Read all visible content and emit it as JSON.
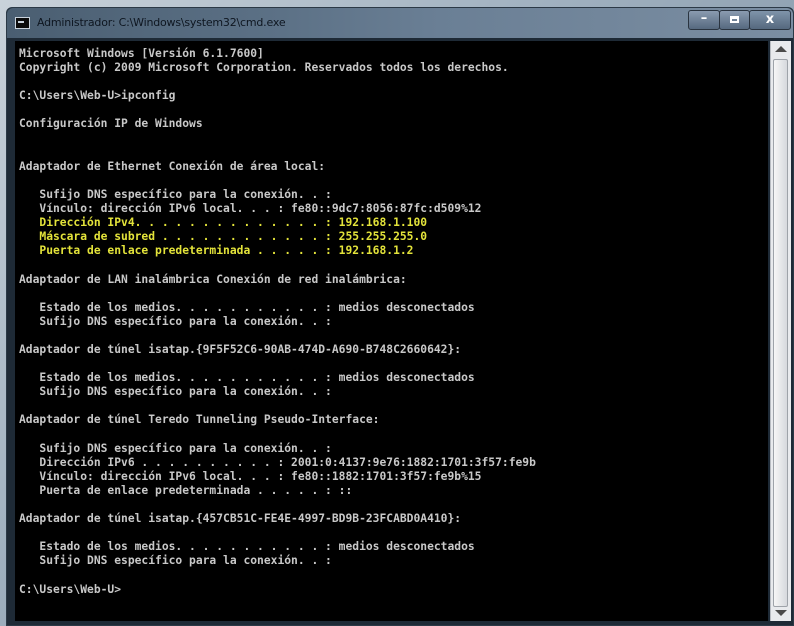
{
  "window": {
    "title": "Administrador: C:\\Windows\\system32\\cmd.exe",
    "controls": {
      "minimize": "–",
      "close": "x"
    }
  },
  "console": {
    "lines": [
      {
        "text": "Microsoft Windows [Versión 6.1.7600]",
        "highlight": false
      },
      {
        "text": "Copyright (c) 2009 Microsoft Corporation. Reservados todos los derechos.",
        "highlight": false
      },
      {
        "text": "",
        "highlight": false
      },
      {
        "text": "C:\\Users\\Web-U>ipconfig",
        "highlight": false
      },
      {
        "text": "",
        "highlight": false
      },
      {
        "text": "Configuración IP de Windows",
        "highlight": false
      },
      {
        "text": "",
        "highlight": false
      },
      {
        "text": "",
        "highlight": false
      },
      {
        "text": "Adaptador de Ethernet Conexión de área local:",
        "highlight": false
      },
      {
        "text": "",
        "highlight": false
      },
      {
        "text": "   Sufijo DNS específico para la conexión. . :",
        "highlight": false
      },
      {
        "text": "   Vínculo: dirección IPv6 local. . . : fe80::9dc7:8056:87fc:d509%12",
        "highlight": false
      },
      {
        "text": "   Dirección IPv4. . . . . . . . . . . . . . : 192.168.1.100",
        "highlight": true
      },
      {
        "text": "   Máscara de subred . . . . . . . . . . . . : 255.255.255.0",
        "highlight": true
      },
      {
        "text": "   Puerta de enlace predeterminada . . . . . : 192.168.1.2",
        "highlight": true
      },
      {
        "text": "",
        "highlight": false
      },
      {
        "text": "Adaptador de LAN inalámbrica Conexión de red inalámbrica:",
        "highlight": false
      },
      {
        "text": "",
        "highlight": false
      },
      {
        "text": "   Estado de los medios. . . . . . . . . . . : medios desconectados",
        "highlight": false
      },
      {
        "text": "   Sufijo DNS específico para la conexión. . :",
        "highlight": false
      },
      {
        "text": "",
        "highlight": false
      },
      {
        "text": "Adaptador de túnel isatap.{9F5F52C6-90AB-474D-A690-B748C2660642}:",
        "highlight": false
      },
      {
        "text": "",
        "highlight": false
      },
      {
        "text": "   Estado de los medios. . . . . . . . . . . : medios desconectados",
        "highlight": false
      },
      {
        "text": "   Sufijo DNS específico para la conexión. . :",
        "highlight": false
      },
      {
        "text": "",
        "highlight": false
      },
      {
        "text": "Adaptador de túnel Teredo Tunneling Pseudo-Interface:",
        "highlight": false
      },
      {
        "text": "",
        "highlight": false
      },
      {
        "text": "   Sufijo DNS específico para la conexión. . :",
        "highlight": false
      },
      {
        "text": "   Dirección IPv6 . . . . . . . . . . : 2001:0:4137:9e76:1882:1701:3f57:fe9b",
        "highlight": false
      },
      {
        "text": "   Vínculo: dirección IPv6 local. . . : fe80::1882:1701:3f57:fe9b%15",
        "highlight": false
      },
      {
        "text": "   Puerta de enlace predeterminada . . . . . : ::",
        "highlight": false
      },
      {
        "text": "",
        "highlight": false
      },
      {
        "text": "Adaptador de túnel isatap.{457CB51C-FE4E-4997-BD9B-23FCABD0A410}:",
        "highlight": false
      },
      {
        "text": "",
        "highlight": false
      },
      {
        "text": "   Estado de los medios. . . . . . . . . . . : medios desconectados",
        "highlight": false
      },
      {
        "text": "   Sufijo DNS específico para la conexión. . :",
        "highlight": false
      },
      {
        "text": "",
        "highlight": false
      },
      {
        "text": "C:\\Users\\Web-U>",
        "highlight": false
      }
    ]
  },
  "colors": {
    "console_text": "#c8c8c8",
    "highlight_text": "#e3e33a",
    "console_background": "#000000"
  }
}
